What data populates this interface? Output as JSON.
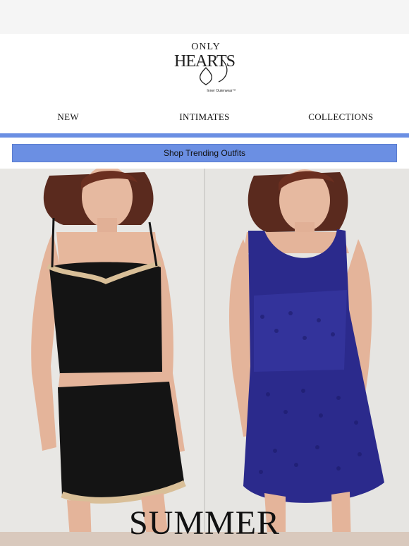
{
  "brand": {
    "name_line1": "ONLY",
    "name_line2": "HEARTS",
    "tagline": "Inner Outerwear™"
  },
  "nav": {
    "items": [
      {
        "label": "NEW"
      },
      {
        "label": "INTIMATES"
      },
      {
        "label": "COLLECTIONS"
      }
    ]
  },
  "cta": {
    "label": "Shop Trending Outfits"
  },
  "hero": {
    "headline": "SUMMER"
  },
  "colors": {
    "accent": "#6b8fe3",
    "top_bar": "#f5f5f5"
  },
  "icons": [
    "brand-logo"
  ]
}
